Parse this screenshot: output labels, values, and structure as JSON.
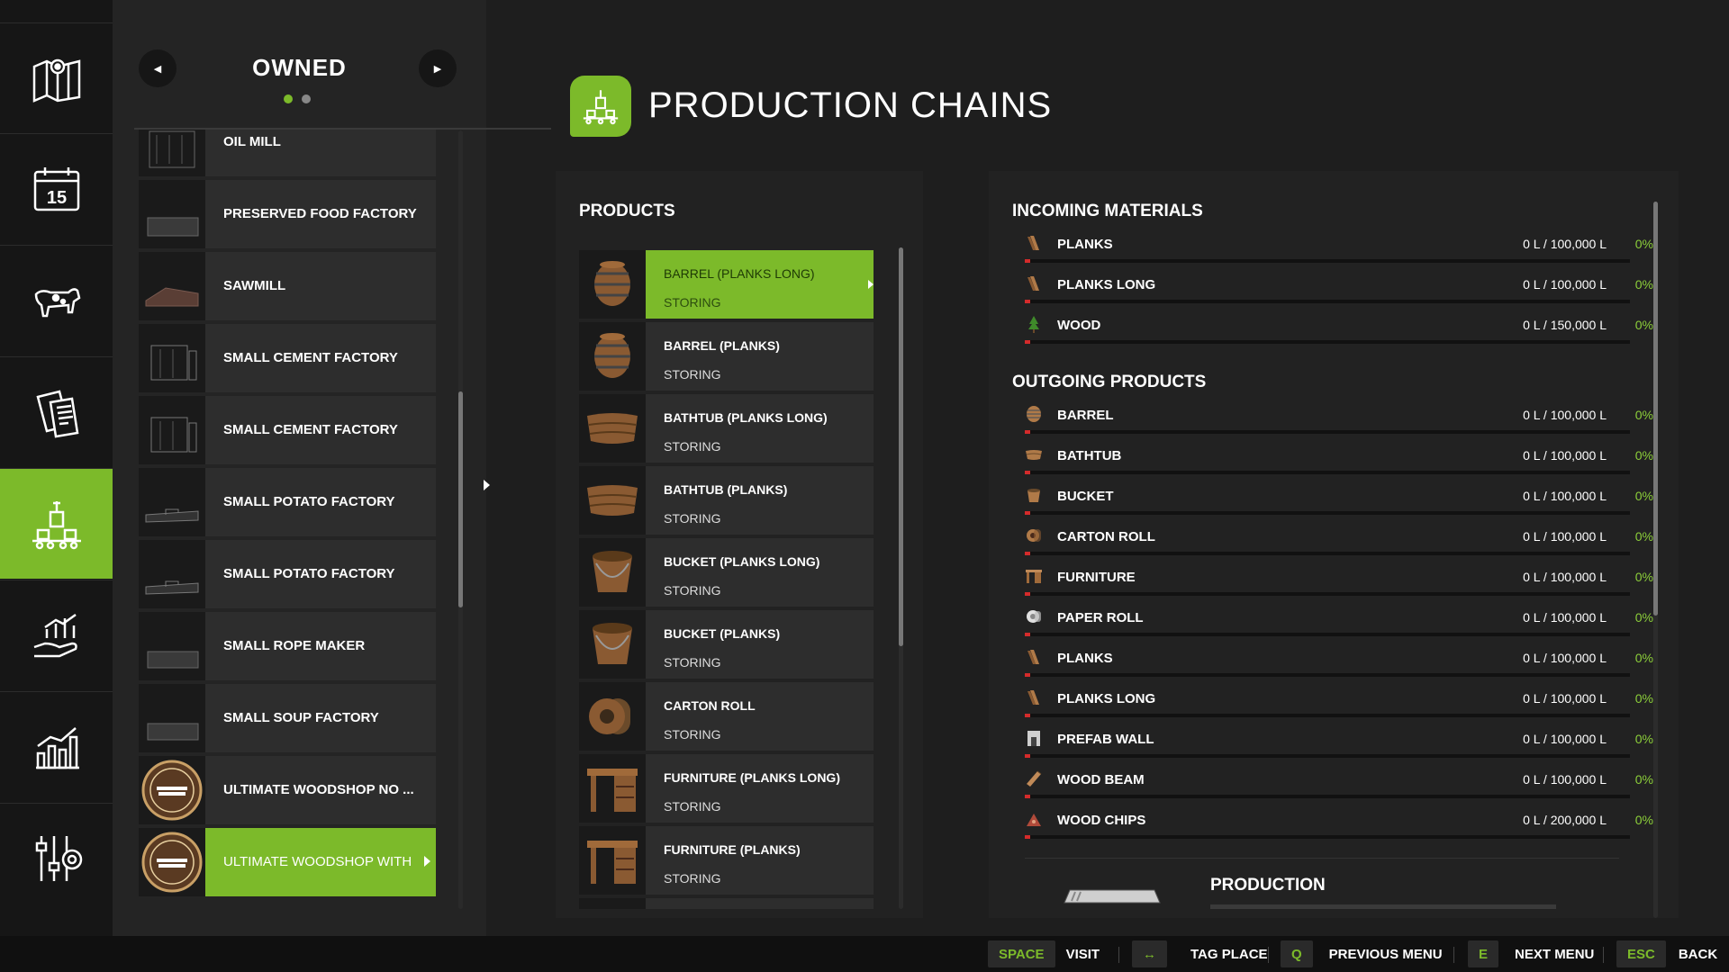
{
  "nav": {
    "items": [
      {
        "name": "map",
        "icon": "map-icon"
      },
      {
        "name": "calendar",
        "icon": "calendar-icon",
        "text": "15"
      },
      {
        "name": "animals",
        "icon": "cow-icon"
      },
      {
        "name": "contracts",
        "icon": "documents-icon"
      },
      {
        "name": "production",
        "icon": "production-icon",
        "active": true
      },
      {
        "name": "finances",
        "icon": "finance-hand-icon"
      },
      {
        "name": "statistics",
        "icon": "bar-chart-icon"
      },
      {
        "name": "settings",
        "icon": "settings-sliders-icon"
      }
    ]
  },
  "list": {
    "title": "OWNED",
    "prev_icon": "triangle-left-icon",
    "next_icon": "triangle-right-icon",
    "items": [
      {
        "label": "OIL MILL"
      },
      {
        "label": "PRESERVED FOOD FACTORY"
      },
      {
        "label": "SAWMILL"
      },
      {
        "label": "SMALL CEMENT FACTORY"
      },
      {
        "label": "SMALL CEMENT FACTORY"
      },
      {
        "label": "SMALL POTATO FACTORY"
      },
      {
        "label": "SMALL POTATO FACTORY"
      },
      {
        "label": "SMALL ROPE MAKER"
      },
      {
        "label": "SMALL SOUP FACTORY"
      },
      {
        "label": "ULTIMATE WOODSHOP NO ...",
        "logo": true
      },
      {
        "label": "ULTIMATE WOODSHOP WITH",
        "logo": true,
        "selected": true
      }
    ]
  },
  "main": {
    "title": "PRODUCTION CHAINS"
  },
  "products": {
    "title": "PRODUCTS",
    "items": [
      {
        "name": "BARREL (PLANKS LONG)",
        "status": "STORING",
        "icon": "barrel-icon",
        "selected": true
      },
      {
        "name": "BARREL (PLANKS)",
        "status": "STORING",
        "icon": "barrel-icon"
      },
      {
        "name": "BATHTUB (PLANKS LONG)",
        "status": "STORING",
        "icon": "bathtub-icon"
      },
      {
        "name": "BATHTUB (PLANKS)",
        "status": "STORING",
        "icon": "bathtub-icon"
      },
      {
        "name": "BUCKET (PLANKS LONG)",
        "status": "STORING",
        "icon": "bucket-icon"
      },
      {
        "name": "BUCKET (PLANKS)",
        "status": "STORING",
        "icon": "bucket-icon"
      },
      {
        "name": "CARTON ROLL",
        "status": "STORING",
        "icon": "carton-roll-icon"
      },
      {
        "name": "FURNITURE (PLANKS LONG)",
        "status": "STORING",
        "icon": "furniture-icon"
      },
      {
        "name": "FURNITURE (PLANKS)",
        "status": "STORING",
        "icon": "furniture-icon"
      }
    ]
  },
  "incoming": {
    "title": "INCOMING MATERIALS",
    "items": [
      {
        "name": "PLANKS",
        "amount": "0 L / 100,000 L",
        "percent": "0%",
        "fill": 0,
        "icon": "planks-icon"
      },
      {
        "name": "PLANKS LONG",
        "amount": "0 L / 100,000 L",
        "percent": "0%",
        "fill": 0,
        "icon": "planks-icon"
      },
      {
        "name": "WOOD",
        "amount": "0 L / 150,000 L",
        "percent": "0%",
        "fill": 0,
        "icon": "tree-icon"
      }
    ]
  },
  "outgoing": {
    "title": "OUTGOING PRODUCTS",
    "items": [
      {
        "name": "BARREL",
        "amount": "0 L / 100,000 L",
        "percent": "0%",
        "fill": 0,
        "icon": "barrel-icon"
      },
      {
        "name": "BATHTUB",
        "amount": "0 L / 100,000 L",
        "percent": "0%",
        "fill": 0,
        "icon": "bathtub-icon"
      },
      {
        "name": "BUCKET",
        "amount": "0 L / 100,000 L",
        "percent": "0%",
        "fill": 0,
        "icon": "bucket-icon"
      },
      {
        "name": "CARTON ROLL",
        "amount": "0 L / 100,000 L",
        "percent": "0%",
        "fill": 0,
        "icon": "carton-roll-icon"
      },
      {
        "name": "FURNITURE",
        "amount": "0 L / 100,000 L",
        "percent": "0%",
        "fill": 0,
        "icon": "furniture-icon"
      },
      {
        "name": "PAPER ROLL",
        "amount": "0 L / 100,000 L",
        "percent": "0%",
        "fill": 0,
        "icon": "paper-roll-icon"
      },
      {
        "name": "PLANKS",
        "amount": "0 L / 100,000 L",
        "percent": "0%",
        "fill": 0,
        "icon": "planks-icon"
      },
      {
        "name": "PLANKS LONG",
        "amount": "0 L / 100,000 L",
        "percent": "0%",
        "fill": 0,
        "icon": "planks-icon"
      },
      {
        "name": "PREFAB WALL",
        "amount": "0 L / 100,000 L",
        "percent": "0%",
        "fill": 0,
        "icon": "prefab-wall-icon"
      },
      {
        "name": "WOOD BEAM",
        "amount": "0 L / 100,000 L",
        "percent": "0%",
        "fill": 0,
        "icon": "wood-beam-icon"
      },
      {
        "name": "WOOD CHIPS",
        "amount": "0 L / 200,000 L",
        "percent": "0%",
        "fill": 0,
        "icon": "wood-chips-icon"
      }
    ]
  },
  "production": {
    "title": "PRODUCTION"
  },
  "footer": {
    "actions": [
      {
        "key": "SPACE",
        "label": "VISIT"
      },
      {
        "key": "↔",
        "label": "TAG PLACE"
      },
      {
        "key": "Q",
        "label": "PREVIOUS MENU"
      },
      {
        "key": "E",
        "label": "NEXT MENU"
      },
      {
        "key": "ESC",
        "label": "BACK"
      }
    ]
  },
  "colors": {
    "accent": "#7cba2a",
    "fill_low": "#d42b2b",
    "percent": "#8ccf3a",
    "panel": "#222222",
    "row": "#2d2d2d"
  }
}
